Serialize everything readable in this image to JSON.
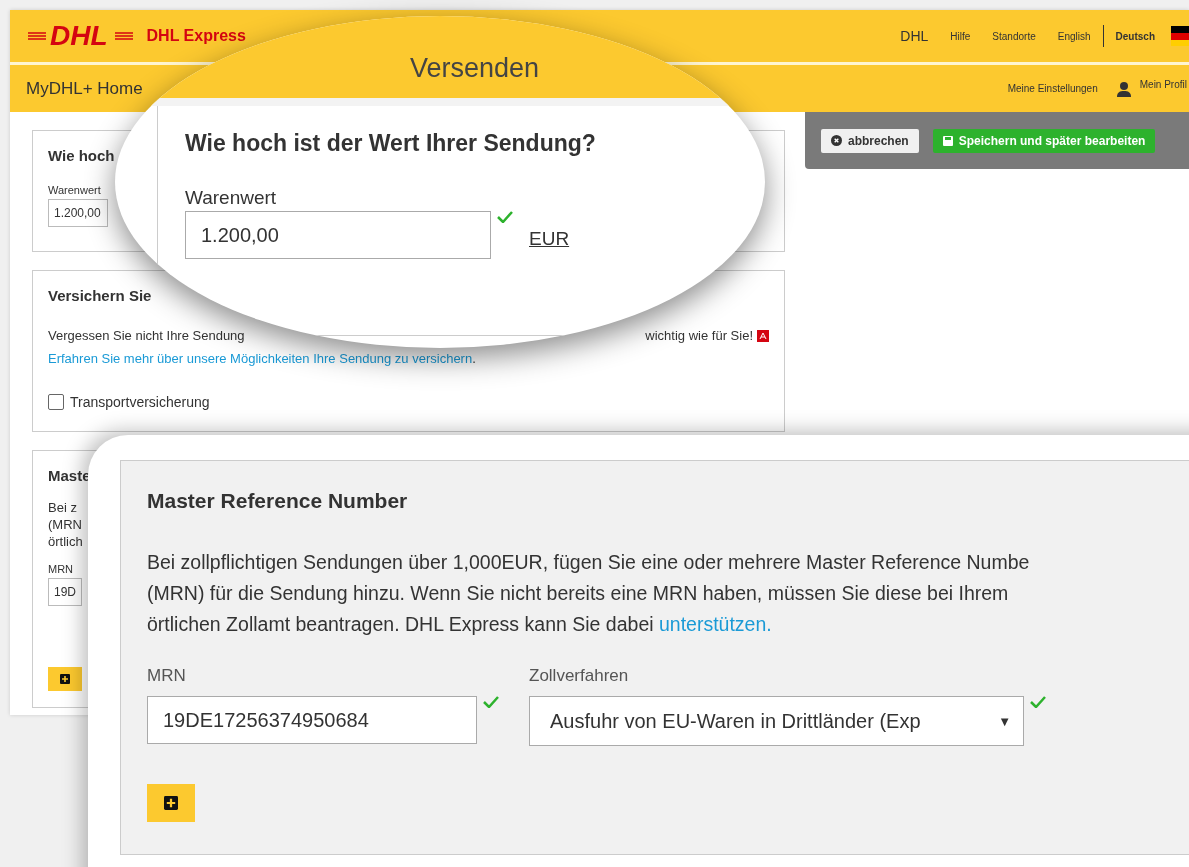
{
  "header": {
    "logo": "DHL",
    "brand": "DHL Express",
    "links": [
      {
        "label": "DHL"
      },
      {
        "label": "Hilfe"
      },
      {
        "label": "Standorte"
      }
    ],
    "languages": [
      {
        "label": "English",
        "selected": false
      },
      {
        "label": "Deutsch",
        "selected": true
      }
    ]
  },
  "nav": {
    "items": [
      {
        "label": "MyDHL+ Home"
      }
    ],
    "settings": "Meine Einstellungen",
    "profile": "Mein Profil"
  },
  "actions": {
    "cancel": "abbrechen",
    "save": "Speichern und später bearbeiten"
  },
  "value_panel": {
    "title": "Wie hoch",
    "label": "Warenwert",
    "value": "1.200,00"
  },
  "insurance_panel": {
    "title": "Versichern Sie",
    "text_start": "Vergessen Sie nicht Ihre Sendung",
    "text_end": "wichtig wie für Sie!",
    "link": "Erfahren Sie mehr über unsere Möglichkeiten Ihre Sendung zu versichern",
    "link_after": ".",
    "checkbox": {
      "label": "Transportversicherung",
      "checked": false
    }
  },
  "mrn_panel": {
    "title": "Maste",
    "lines": [
      "Bei z",
      "(MRN",
      "örtlich"
    ],
    "label": "MRN",
    "value": "19D"
  },
  "zoom_value": {
    "nav_item": "Versenden",
    "title": "Wie hoch ist der Wert Ihrer Sendung?",
    "label": "Warenwert",
    "value": "1.200,00",
    "valid": true,
    "currency": "EUR"
  },
  "zoom_mrn": {
    "title": "Master Reference Number",
    "text": "Bei zollpflichtigen Sendungen über 1,000EUR, fügen Sie eine oder mehrere Master Reference Numbe\n(MRN) für die Sendung hinzu. Wenn Sie nicht bereits eine MRN haben, müssen Sie diese bei Ihrem\nörtlichen Zollamt beantragen. DHL Express kann Sie dabei ",
    "link": "unterstützen.",
    "fields": [
      {
        "kind": "input",
        "label": "MRN",
        "value": "19DE17256374950684",
        "valid": true
      },
      {
        "kind": "select",
        "label": "Zollverfahren",
        "value": "Ausfuhr von EU-Waren in Drittländer (Exp",
        "caret": "▼",
        "valid": true
      }
    ]
  }
}
